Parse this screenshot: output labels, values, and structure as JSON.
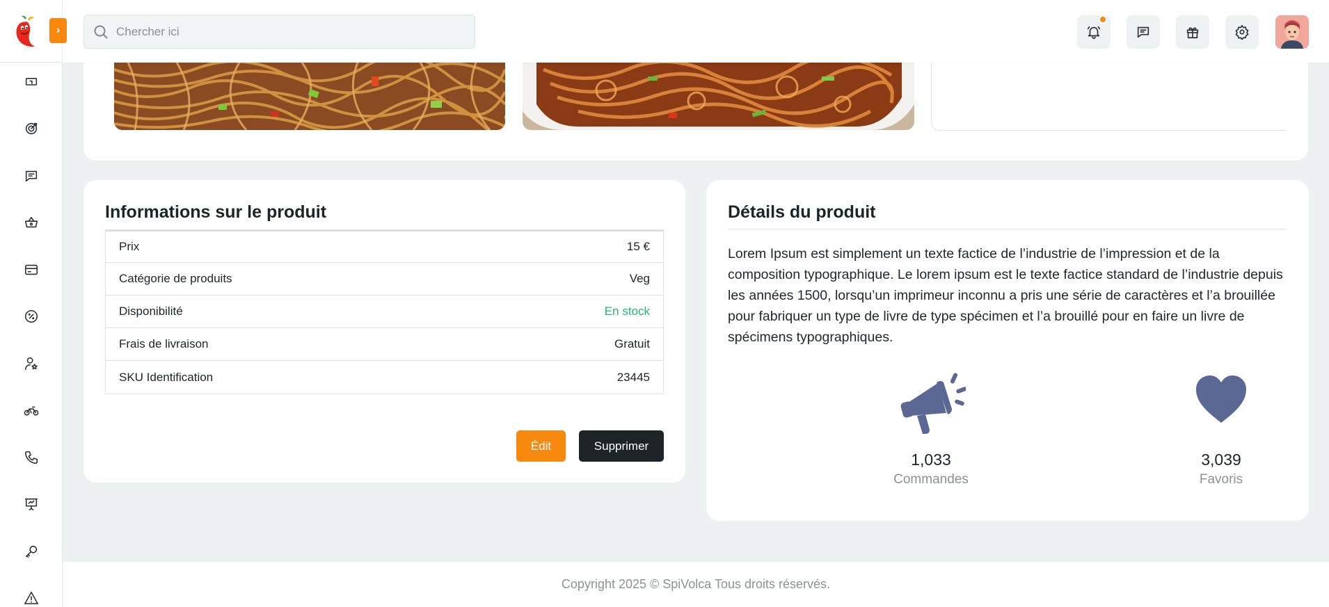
{
  "header": {
    "search_placeholder": "Chercher ici",
    "toggle_glyph": "›",
    "icons": [
      "bell-icon",
      "chat-icon",
      "gift-icon",
      "settings-icon"
    ]
  },
  "sidebar": {
    "icons": [
      "calendar-icon",
      "target-icon",
      "message-icon",
      "basket-icon",
      "card-icon",
      "percent-icon",
      "user-star-icon",
      "bike-icon",
      "phone-icon",
      "presentation-icon",
      "key-icon",
      "warning-icon"
    ]
  },
  "product_info": {
    "title": "Informations sur le produit",
    "rows": [
      {
        "label": "Prix",
        "value": "15 €"
      },
      {
        "label": "Catégorie de produits",
        "value": "Veg"
      },
      {
        "label": "Disponibilité",
        "value": "En stock"
      },
      {
        "label": "Frais de livraison",
        "value": "Gratuit"
      },
      {
        "label": "SKU Identification",
        "value": "23445"
      }
    ],
    "edit_label": "Édit",
    "delete_label": "Supprimer"
  },
  "product_details": {
    "title": "Détails du produit",
    "description": "Lorem Ipsum est simplement un texte factice de l’industrie de l’impression et de la composition typographique. Le lorem ipsum est le texte factice standard de l’industrie depuis les années 1500, lorsqu’un imprimeur inconnu a pris une série de caractères et l’a brouillée pour fabriquer un type de livre de type spécimen et l’a brouillé pour en faire un livre de spécimens typographiques.",
    "stats": [
      {
        "value": "1,033",
        "label": "Commandes",
        "icon": "megaphone-icon"
      },
      {
        "value": "3,039",
        "label": "Favoris",
        "icon": "heart-icon"
      }
    ]
  },
  "footer": {
    "copyright": "Copyright 2025 © SpiVolca Tous droits réservés."
  },
  "colors": {
    "accent": "#f7890e",
    "dark_button": "#1e2328",
    "stock_green": "#27b37a",
    "stat_icon": "#5b6894",
    "background": "#eef1f1"
  }
}
